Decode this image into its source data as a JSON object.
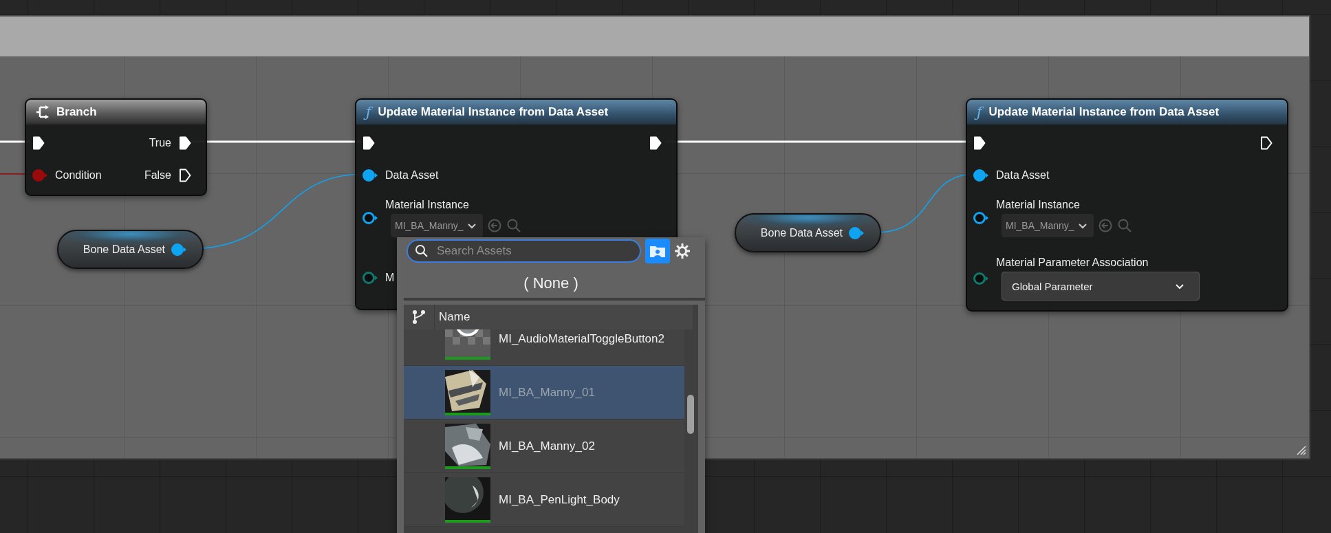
{
  "branch_node": {
    "title": "Branch",
    "exec_in": {
      "connected": true
    },
    "condition": {
      "label": "Condition",
      "color": "#9b0a0a",
      "connected": true
    },
    "outputs": [
      {
        "label": "True",
        "connected": true
      },
      {
        "label": "False",
        "connected": false
      }
    ]
  },
  "variable_nodes": [
    {
      "label": "Bone Data Asset",
      "color": "#0fa4f2",
      "connected": true
    },
    {
      "label": "Bone Data Asset",
      "color": "#0fa4f2",
      "connected": true
    }
  ],
  "function_nodes": [
    {
      "icon": "ƒ",
      "title": "Update Material Instance from Data Asset",
      "exec_in": {
        "connected": true
      },
      "exec_out": {
        "connected": true
      },
      "inputs": [
        {
          "kind": "object",
          "label": "Data Asset",
          "color": "#0fa4f2",
          "connected": true
        },
        {
          "kind": "asset",
          "label": "Material Instance",
          "color": "#0fa4f2",
          "connected": false,
          "value": "MI_BA_Manny_"
        },
        {
          "kind": "enum",
          "label": "M",
          "color": "#0e7a6c",
          "connected": false
        }
      ]
    },
    {
      "icon": "ƒ",
      "title": "Update Material Instance from Data Asset",
      "exec_in": {
        "connected": true
      },
      "exec_out": {
        "connected": false
      },
      "inputs": [
        {
          "kind": "object",
          "label": "Data Asset",
          "color": "#0fa4f2",
          "connected": true
        },
        {
          "kind": "asset",
          "label": "Material Instance",
          "color": "#0fa4f2",
          "connected": false,
          "value": "MI_BA_Manny_"
        },
        {
          "kind": "enum",
          "label": "Material Parameter Association",
          "color": "#0e7a6c",
          "connected": false,
          "value": "Global Parameter"
        }
      ]
    }
  ],
  "asset_picker": {
    "search": {
      "placeholder": "Search Assets"
    },
    "none_option": "( None )",
    "column": "Name",
    "assets": [
      {
        "name": "MI_AudioMaterialToggleButton2",
        "selected": false
      },
      {
        "name": "MI_BA_Manny_01",
        "selected": true
      },
      {
        "name": "MI_BA_Manny_02",
        "selected": false
      },
      {
        "name": "MI_BA_PenLight_Body",
        "selected": false
      }
    ]
  }
}
